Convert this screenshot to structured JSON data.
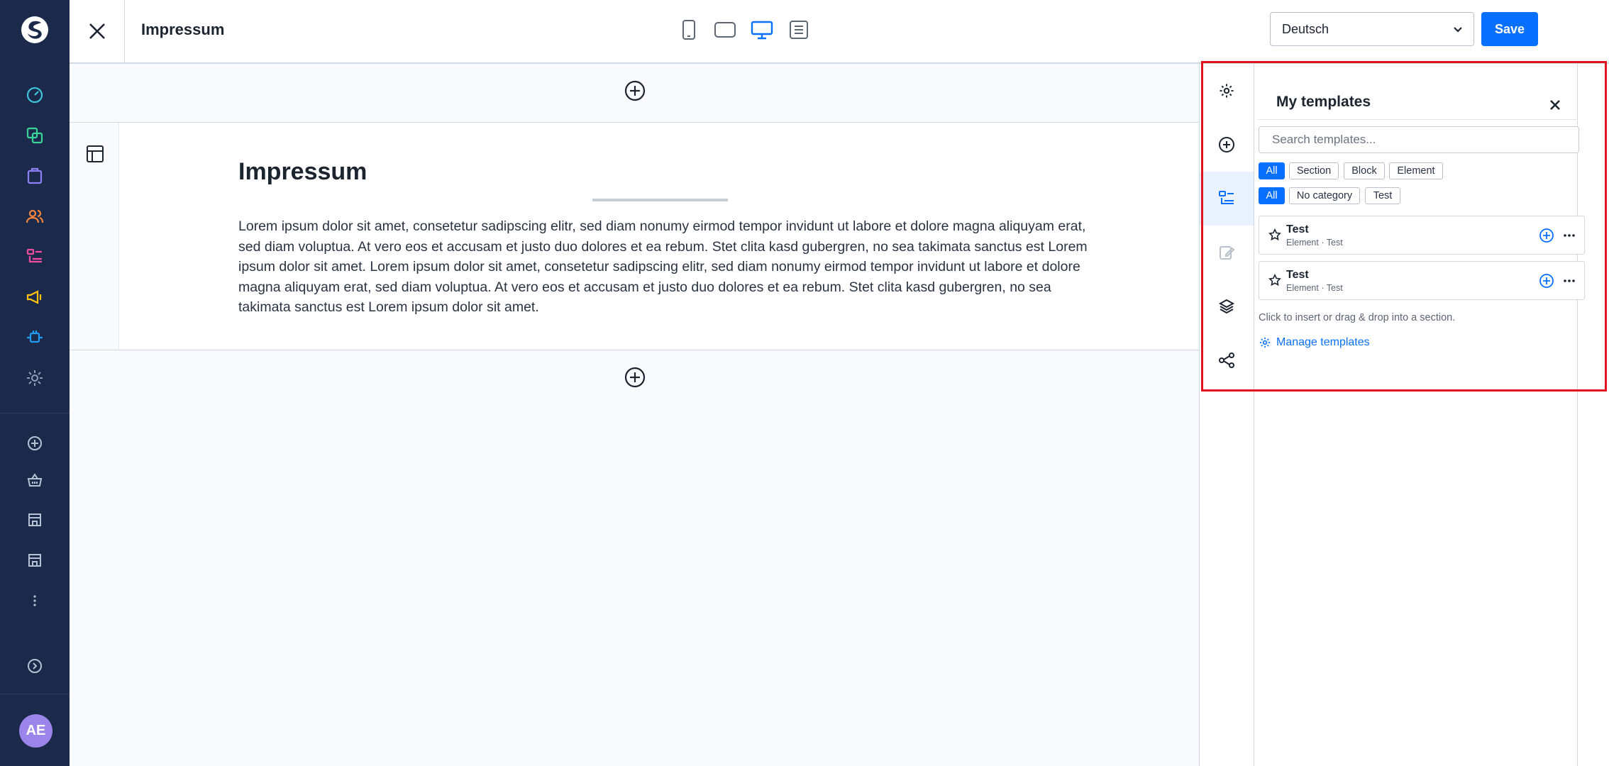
{
  "colors": {
    "sidebar_bg": "#1b2a4a",
    "accent": "#0870ff",
    "avatar_bg": "#9b84ea",
    "highlight": "#e0141e"
  },
  "admin_sidebar": {
    "icons": [
      "shopware-logo-icon",
      "dashboard-icon",
      "catalogue-icon",
      "orders-icon",
      "customers-icon",
      "content-icon",
      "marketing-icon",
      "extensions-icon",
      "settings-icon",
      "add-sales-channel-icon",
      "storefront-icon",
      "sales-channel-icon",
      "sales-channel-icon",
      "more-icon",
      "expand-icon"
    ],
    "avatar_initials": "AE"
  },
  "topbar": {
    "title": "Impressum",
    "devices": [
      "mobile-icon",
      "tablet-icon",
      "desktop-icon",
      "form-icon"
    ],
    "language": "Deutsch",
    "save_label": "Save"
  },
  "content": {
    "heading": "Impressum",
    "body": "Lorem ipsum dolor sit amet, consetetur sadipscing elitr, sed diam nonumy eirmod tempor invidunt ut labore et dolore magna aliquyam erat, sed diam voluptua. At vero eos et accusam et justo duo dolores et ea rebum. Stet clita kasd gubergren, no sea takimata sanctus est Lorem ipsum dolor sit amet. Lorem ipsum dolor sit amet, consetetur sadipscing elitr, sed diam nonumy eirmod tempor invidunt ut labore et dolore magna aliquyam erat, sed diam voluptua. At vero eos et accusam et justo duo dolores et ea rebum. Stet clita kasd gubergren, no sea takimata sanctus est Lorem ipsum dolor sit amet."
  },
  "templates_panel": {
    "title": "My templates",
    "search_placeholder": "Search templates...",
    "type_filters": [
      "All",
      "Section",
      "Block",
      "Element"
    ],
    "category_filters": [
      "All",
      "No category",
      "Test"
    ],
    "items": [
      {
        "name": "Test",
        "meta": "Element · Test"
      },
      {
        "name": "Test",
        "meta": "Element · Test"
      }
    ],
    "hint": "Click to insert or drag & drop into a section.",
    "manage_label": "Manage templates"
  }
}
